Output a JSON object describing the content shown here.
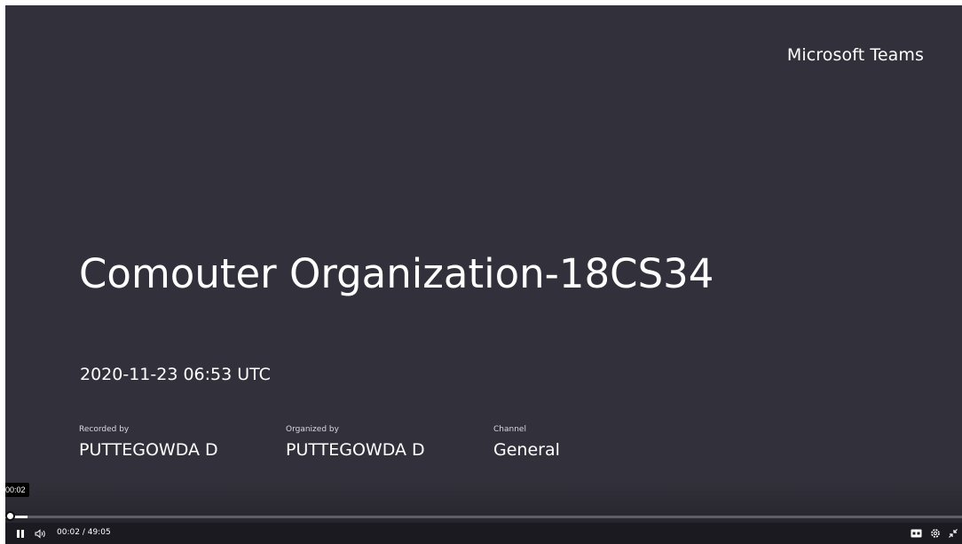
{
  "slide": {
    "brand": "Microsoft Teams",
    "title": "Comouter Organization-18CS34",
    "datetime": "2020-11-23 06:53 UTC",
    "recorded_by_label": "Recorded by",
    "recorded_by_value": "PUTTEGOWDA D",
    "organized_by_label": "Organized by",
    "organized_by_value": "PUTTEGOWDA D",
    "channel_label": "Channel",
    "channel_value": "General"
  },
  "player": {
    "tooltip_time": "00:02",
    "current_time": "00:02",
    "separator": "/",
    "duration": "49:05",
    "progress_fraction": 0.0007,
    "icons": {
      "play_pause": "pause-icon",
      "volume": "volume-icon",
      "captions": "captions-icon",
      "settings": "gear-icon",
      "fullscreen": "collapse-fullscreen-icon"
    }
  },
  "colors": {
    "background": "#32313b",
    "control_bar": "#1b1a20",
    "text": "#ffffff"
  }
}
